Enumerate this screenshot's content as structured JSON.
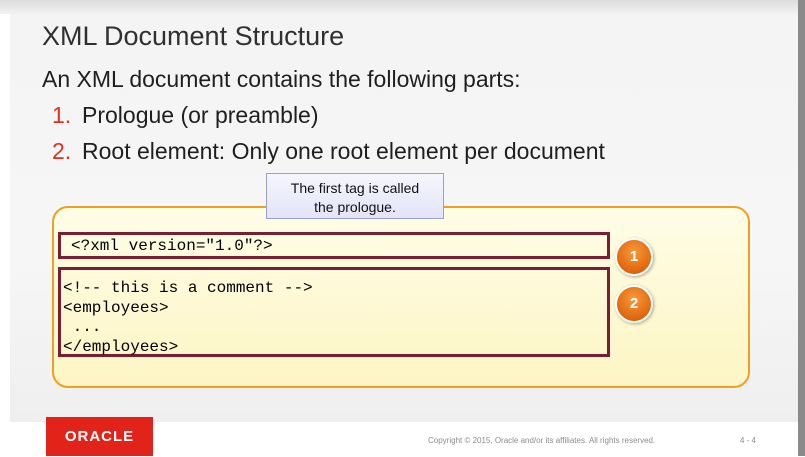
{
  "slide": {
    "title": "XML Document Structure",
    "subtitle": "An XML document contains the following parts:",
    "list": [
      {
        "number": "1.",
        "text": "Prologue (or preamble)"
      },
      {
        "number": "2.",
        "text": "Root element: Only one root element per document"
      }
    ]
  },
  "callout": {
    "line1": "The first tag is called",
    "line2": "the prologue."
  },
  "code": {
    "box1": [
      "<?xml version=\"1.0\"?>"
    ],
    "box2": [
      "<!-- this is a comment -->",
      "<employees>",
      " ...",
      "</employees>"
    ]
  },
  "badges": [
    "1",
    "2"
  ],
  "footer": {
    "logo": "ORACLE",
    "copyright": "Copyright © 2015, Oracle and/or its affiliates. All rights reserved.",
    "page": "4 - 4"
  },
  "colors": {
    "accent_red": "#e0301e",
    "code_border": "#7a1e33",
    "panel_border": "#f0a020",
    "badge_orange": "#e56d12",
    "oracle_red": "#e2231a"
  }
}
